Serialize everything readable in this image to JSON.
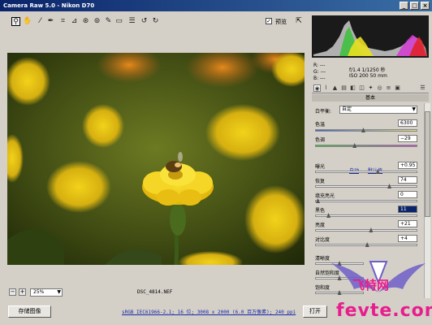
{
  "window": {
    "title": "Camera Raw 5.0 - Nikon D70",
    "buttons": [
      "_",
      "□",
      "×"
    ]
  },
  "toolbar": {
    "tools": [
      "zoom-icon",
      "hand-icon",
      "white-balance-icon",
      "color-sampler-icon",
      "crop-icon",
      "straighten-icon",
      "spot-removal-icon",
      "red-eye-icon",
      "adjustment-brush-icon",
      "graduated-filter-icon",
      "preferences-icon",
      "rotate-left-icon",
      "rotate-right-icon"
    ],
    "preview_checked": true,
    "preview_label": "预览"
  },
  "image": {
    "description_icon": "marigold-photo"
  },
  "status": {
    "zoom_minus": "−",
    "zoom_plus": "+",
    "zoom_value": "25%",
    "filename": "DSC_4814.NEF"
  },
  "bottom": {
    "save_label": "存储图像",
    "workflow_link": "sRGB IEC61966-2.1; 16 位; 3008 x 2000 (6.0 百万像素); 240 ppi",
    "open_label": "打开"
  },
  "info": {
    "r": "R: ---",
    "g": "G: ---",
    "b": "B: ---",
    "exposure": "f/1.4  1/1250 秒",
    "iso": "ISO 200   50 mm"
  },
  "panel": {
    "section_title": "基本",
    "wb_label": "白平衡:",
    "wb_value": "自定",
    "auto_label": "自动",
    "default_label": "默认值",
    "controls": [
      {
        "label": "色温",
        "value": "6300",
        "level": 0.47
      },
      {
        "label": "色调",
        "value": "−29",
        "level": 0.38
      },
      {
        "label": "曝光",
        "value": "+0.95",
        "level": 0.62
      },
      {
        "label": "恢复",
        "value": "74",
        "level": 0.74
      },
      {
        "label": "填充亮光",
        "value": "0",
        "level": 0.0
      },
      {
        "label": "黑色",
        "value": "11",
        "level": 0.11
      },
      {
        "label": "亮度",
        "value": "+21",
        "level": 0.55
      },
      {
        "label": "对比度",
        "value": "+4",
        "level": 0.51
      },
      {
        "label": "清晰度",
        "value": "",
        "level": 0.5
      },
      {
        "label": "自然饱和度",
        "value": "",
        "level": 0.5
      },
      {
        "label": "饱和度",
        "value": "",
        "level": 0.5
      }
    ]
  },
  "watermark": {
    "big": "fevte.com",
    "mid": "飞特网"
  },
  "colors": {
    "accent_blue": "#0a246a",
    "link_blue": "#1a2aa8",
    "watermark_pink": "#e81d8d"
  }
}
